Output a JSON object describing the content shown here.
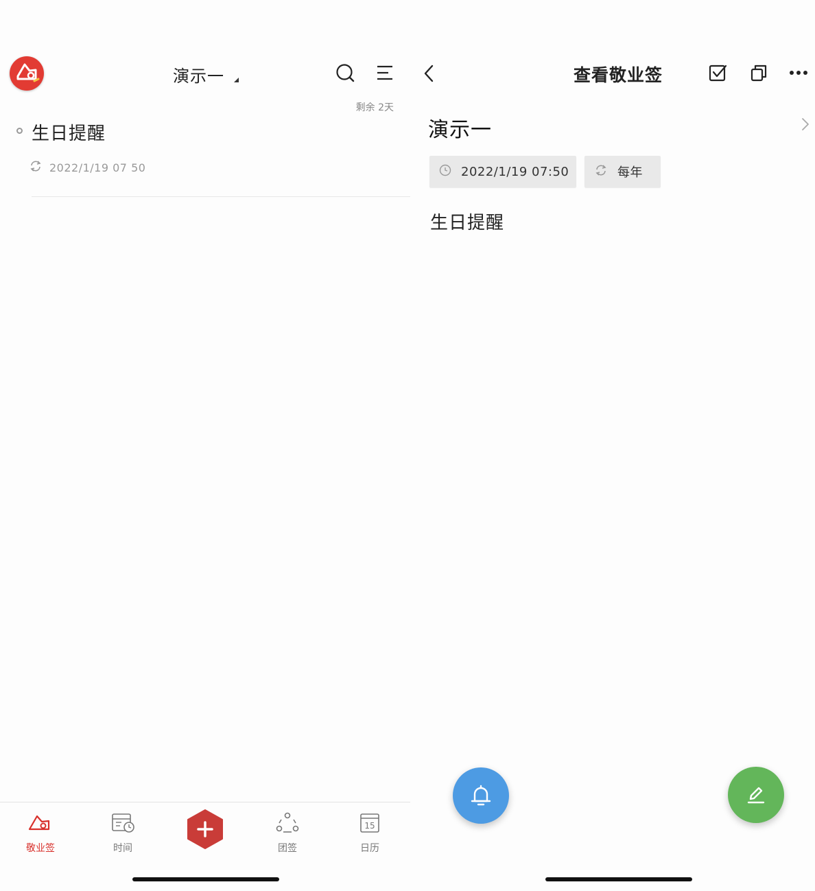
{
  "left": {
    "header": {
      "notebook_title": "演示一"
    },
    "list": {
      "items": [
        {
          "title": "生日提醒",
          "datetime": "2022/1/19 07 50",
          "remaining": "剩余 2天"
        }
      ]
    },
    "tabbar": {
      "tabs": [
        {
          "label": "敬业签",
          "active": true
        },
        {
          "label": "时间",
          "active": false
        },
        {
          "label": "团签",
          "active": false
        },
        {
          "label": "日历",
          "active": false,
          "icon_text": "15"
        }
      ]
    }
  },
  "right": {
    "header": {
      "title": "查看敬业签"
    },
    "note": {
      "notebook": "演示一",
      "datetime": "2022/1/19 07:50",
      "repeat": "每年",
      "content": "生日提醒"
    }
  },
  "colors": {
    "brand_red": "#e23b33",
    "active_tab": "#d8302b",
    "add_button": "#c93c38",
    "reminder_fab": "#4d9be3",
    "edit_fab": "#63b65a"
  },
  "icons": [
    "app-logo",
    "search-icon",
    "list-menu-icon",
    "repeat-icon",
    "clock-icon",
    "back-icon",
    "check-square-icon",
    "copy-icon",
    "more-icon",
    "chevron-right-icon",
    "bell-icon",
    "pencil-icon",
    "plus-icon",
    "calendar-icon",
    "team-icon",
    "time-icon",
    "home-icon"
  ]
}
